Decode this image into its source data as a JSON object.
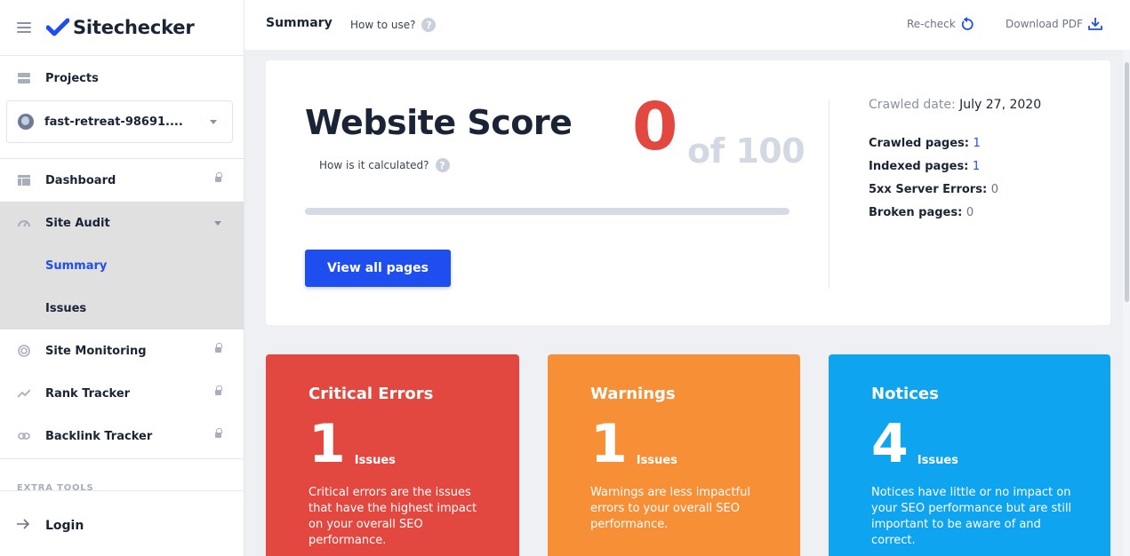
{
  "app": {
    "name": "Sitechecker",
    "brand_color": "#1f4ef0"
  },
  "sidebar": {
    "projects_label": "Projects",
    "project_select": {
      "value": "fast-retreat-98691...."
    },
    "items": [
      {
        "label": "Dashboard",
        "icon": "dashboard-icon",
        "locked": true
      },
      {
        "label": "Site Audit",
        "icon": "gauge-icon",
        "expanded": true,
        "children": [
          {
            "label": "Summary",
            "active": true
          },
          {
            "label": "Issues"
          }
        ]
      },
      {
        "label": "Site Monitoring",
        "icon": "monitoring-icon",
        "locked": true
      },
      {
        "label": "Rank Tracker",
        "icon": "trend-icon",
        "locked": true
      },
      {
        "label": "Backlink Tracker",
        "icon": "link-icon",
        "locked": true
      }
    ],
    "extra_tools_label": "EXTRA TOOLS",
    "login_label": "Login"
  },
  "topbar": {
    "title": "Summary",
    "how_to_use": "How to use?",
    "recheck": "Re-check",
    "download_pdf": "Download PDF"
  },
  "score": {
    "title": "Website Score",
    "how_calculated": "How is it calculated?",
    "value": "0",
    "of_label": "of 100",
    "progress_fraction": 0,
    "view_all_label": "View all pages",
    "crawled_date_label": "Crawled date:",
    "crawled_date": "July 27, 2020",
    "stats": [
      {
        "label": "Crawled pages:",
        "value": "1",
        "link": true
      },
      {
        "label": "Indexed pages:",
        "value": "1",
        "link": true
      },
      {
        "label": "5xx Server Errors:",
        "value": "0",
        "link": false
      },
      {
        "label": "Broken pages:",
        "value": "0",
        "link": false
      }
    ]
  },
  "issues": [
    {
      "title": "Critical Errors",
      "count": "1",
      "unit": "Issues",
      "color": "#e2483f",
      "description": "Critical errors are the issues that have the highest impact on your overall SEO performance."
    },
    {
      "title": "Warnings",
      "count": "1",
      "unit": "Issues",
      "color": "#f68f36",
      "description": "Warnings are less impactful errors to your overall SEO performance."
    },
    {
      "title": "Notices",
      "count": "4",
      "unit": "Issues",
      "color": "#0fa4ef",
      "description": "Notices have little or no impact on your SEO performance but are still important to be aware of and correct."
    }
  ]
}
